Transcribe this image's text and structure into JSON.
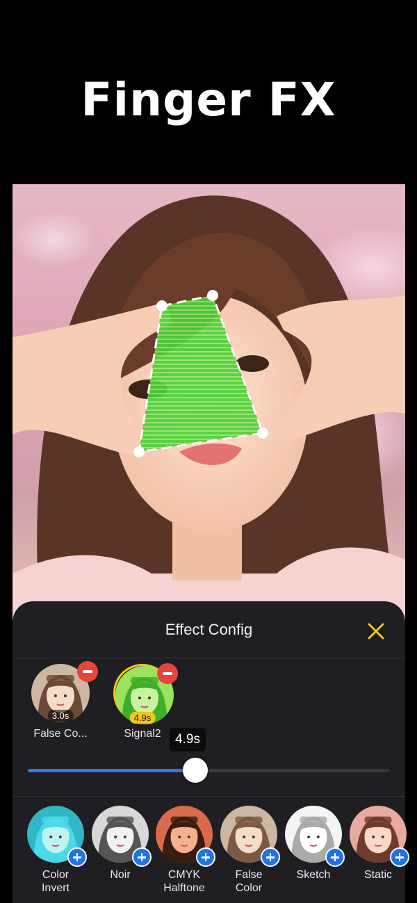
{
  "headline": "Finger FX",
  "panel": {
    "title": "Effect Config",
    "close_icon": "close-x-icon",
    "accent_color": "#f5c518"
  },
  "active_effects": [
    {
      "label": "False Co...",
      "duration": "3.0s",
      "selected": false
    },
    {
      "label": "Signal2",
      "duration": "4.9s",
      "selected": true
    }
  ],
  "slider": {
    "value_label": "4.9s",
    "fraction": 0.44,
    "fill_color": "#2f7be5"
  },
  "library": [
    {
      "label": "Color\nInvert",
      "style": "invert"
    },
    {
      "label": "Noir",
      "style": "noir"
    },
    {
      "label": "CMYK\nHalftone",
      "style": "cmyk"
    },
    {
      "label": "False\nColor",
      "style": "false"
    },
    {
      "label": "Sketch",
      "style": "sketch"
    },
    {
      "label": "Static",
      "style": "static"
    }
  ]
}
